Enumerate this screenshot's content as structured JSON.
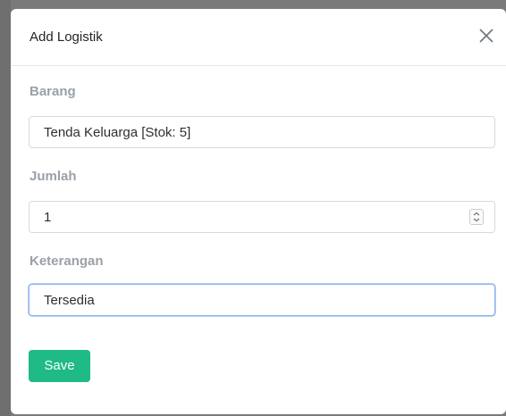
{
  "modal": {
    "title": "Add Logistik",
    "close_icon": "close-icon"
  },
  "form": {
    "barang": {
      "label": "Barang",
      "value": "Tenda Keluarga [Stok: 5]"
    },
    "jumlah": {
      "label": "Jumlah",
      "value": "1",
      "spinner_icon": "spinner-arrows-icon"
    },
    "keterangan": {
      "label": "Keterangan",
      "value": "Tersedia"
    }
  },
  "actions": {
    "save_label": "Save"
  },
  "colors": {
    "save_button": "#1fba85",
    "label_text": "#9aa1a8",
    "focus_border": "#8fb3f0"
  }
}
